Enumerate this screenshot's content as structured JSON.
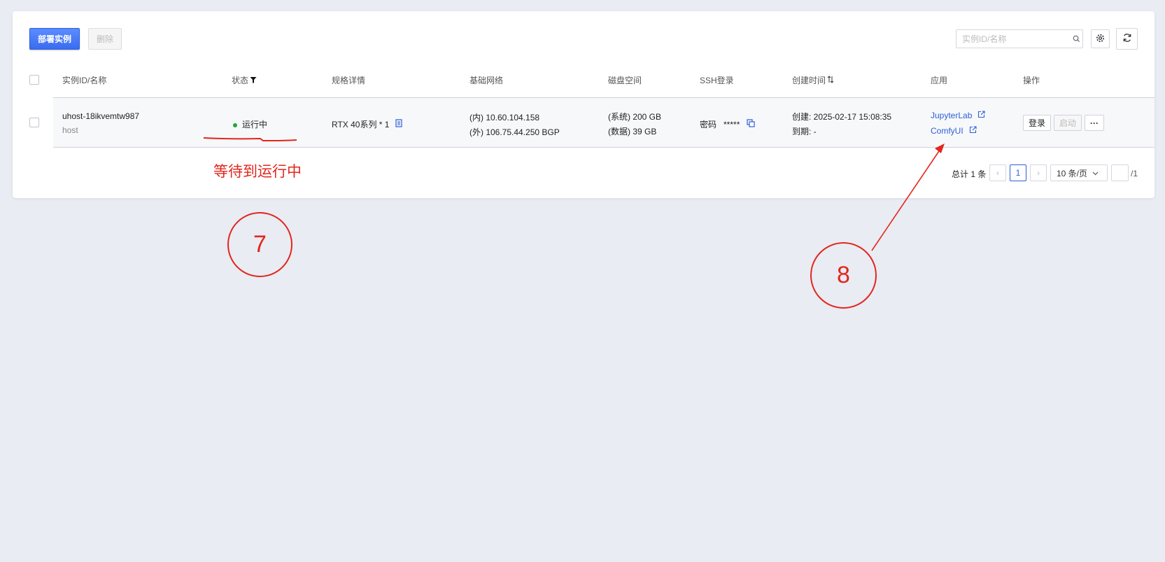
{
  "toolbar": {
    "deploy_label": "部署实例",
    "delete_label": "删除",
    "search_placeholder": "实例ID/名称"
  },
  "table": {
    "headers": {
      "id_name": "实例ID/名称",
      "status": "状态",
      "spec": "规格详情",
      "network": "基础网络",
      "disk": "磁盘空间",
      "ssh": "SSH登录",
      "created": "创建时间",
      "app": "应用",
      "ops": "操作"
    },
    "rows": [
      {
        "id": "uhost-18ikvemtw987",
        "name": "host",
        "status": "运行中",
        "status_color": "#22a63c",
        "spec": "RTX 40系列 * 1",
        "net_inner": "(内) 10.60.104.158",
        "net_outer": "(外) 106.75.44.250 BGP",
        "disk_system": "(系统) 200 GB",
        "disk_data": "(数据) 39 GB",
        "ssh_label": "密码",
        "ssh_password": "*****",
        "created": "创建: 2025-02-17 15:08:35",
        "expire": "到期: -",
        "app_links": [
          "JupyterLab",
          "ComfyUI"
        ],
        "ops": {
          "login": "登录",
          "start": "启动",
          "more": "···"
        }
      }
    ]
  },
  "pagination": {
    "total": "总计 1 条",
    "prev": "‹",
    "current_page": "1",
    "next": "›",
    "page_size": "10 条/页",
    "page_total": "/1"
  },
  "annotations": {
    "note": "等待到运行中",
    "step_7": "7",
    "step_8": "8",
    "color": "#e3261c"
  },
  "colors": {
    "primary": "#3a6cf0",
    "link": "#2d5fd8",
    "background": "#e9ecf3"
  }
}
